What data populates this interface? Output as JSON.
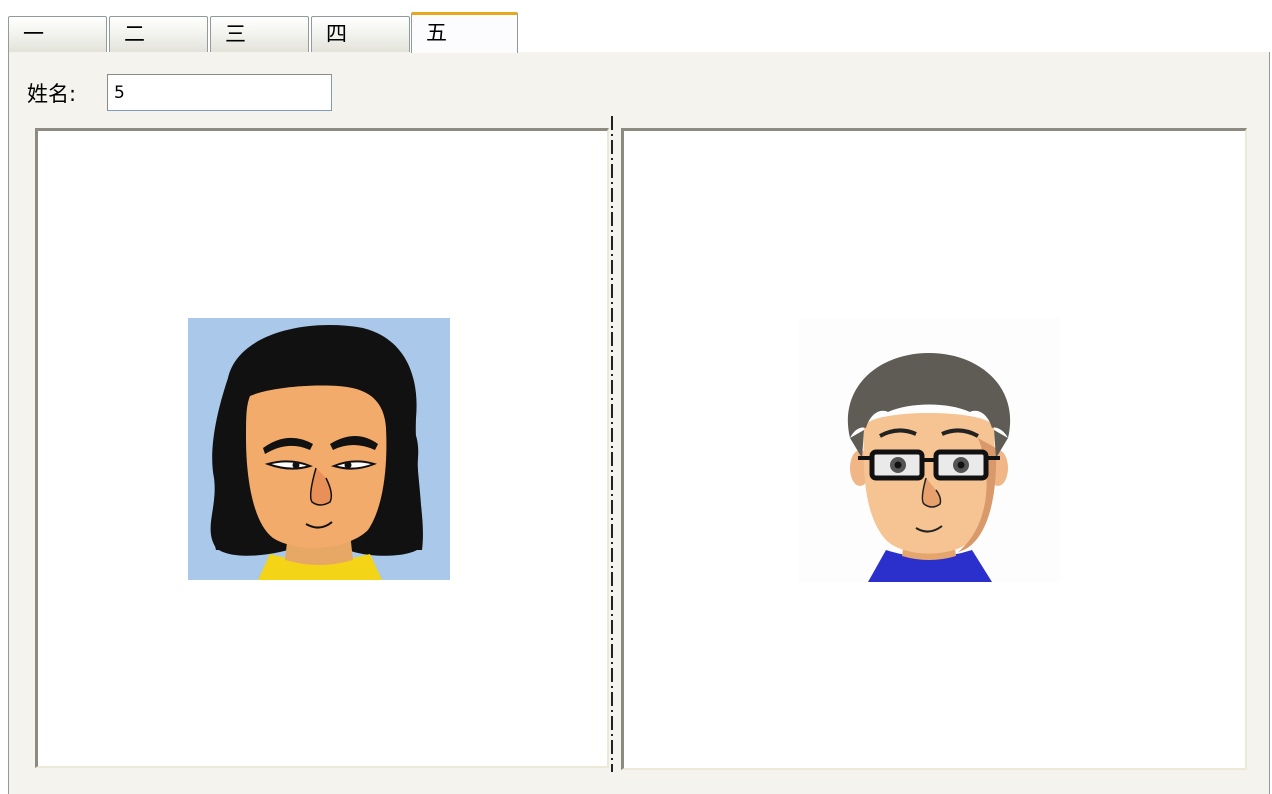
{
  "tabs": [
    {
      "label": "一",
      "selected": false
    },
    {
      "label": "二",
      "selected": false
    },
    {
      "label": "三",
      "selected": false
    },
    {
      "label": "四",
      "selected": false
    },
    {
      "label": "五",
      "selected": true
    }
  ],
  "form": {
    "name_label": "姓名:",
    "name_value": "5"
  },
  "colors": {
    "selected_tab_accent": "#e9a61f",
    "page_background": "#f4f3ee",
    "left_avatar_background": "#a9c8ea",
    "left_avatar_shirt": "#f4d417",
    "right_avatar_shirt": "#2b2fcc"
  },
  "images": {
    "left": "avatar-long-hair",
    "right": "avatar-glasses"
  }
}
